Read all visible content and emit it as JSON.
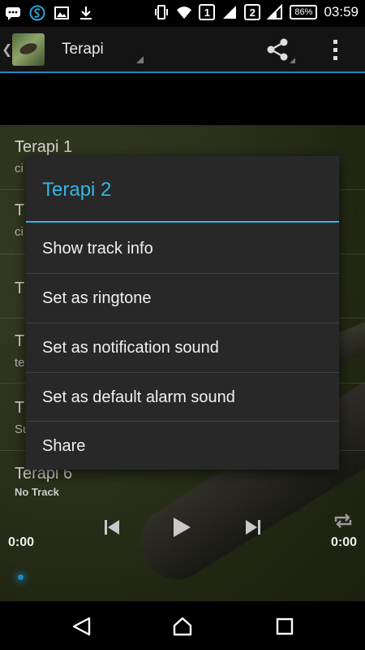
{
  "status_bar": {
    "left_icons": [
      "chat-icon",
      "sync-icon",
      "gallery-icon",
      "download-icon"
    ],
    "right_icons": [
      "vibrate-icon",
      "wifi-icon",
      "signal-icon"
    ],
    "sim1": "1",
    "sim2": "2",
    "battery": "86%",
    "time": "03:59"
  },
  "action_bar": {
    "title": "Terapi",
    "icons": [
      "app-logo-icon",
      "share-icon",
      "overflow-menu-icon"
    ],
    "accent": "#1a8bc6"
  },
  "tracks": [
    {
      "title": "Terapi 1",
      "subtitle": "ci"
    },
    {
      "title": "T",
      "subtitle": "ci"
    },
    {
      "title": "T",
      "subtitle": ""
    },
    {
      "title": "T",
      "subtitle": "te"
    },
    {
      "title": "T",
      "subtitle": "Su"
    },
    {
      "title": "Terapi 6",
      "subtitle": ""
    }
  ],
  "player": {
    "status": "No Track",
    "time_elapsed": "0:00",
    "time_total": "0:00",
    "controls": [
      "previous-icon",
      "play-icon",
      "next-icon",
      "repeat-icon"
    ]
  },
  "dialog": {
    "title": "Terapi 2",
    "accent": "#33b5e5",
    "items": [
      "Show track info",
      "Set as ringtone",
      "Set as notification sound",
      "Set as default alarm sound",
      "Share"
    ]
  },
  "nav_bar": {
    "icons": [
      "back-icon",
      "home-icon",
      "recents-icon"
    ]
  }
}
